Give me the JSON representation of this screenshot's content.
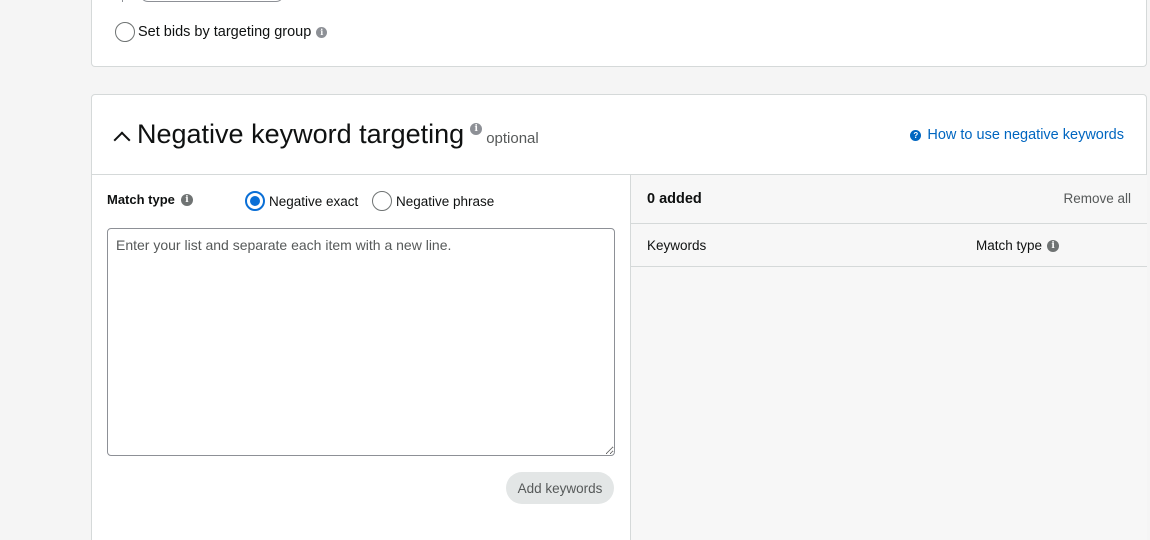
{
  "bidding": {
    "set_bids_by_group_label": "Set bids by targeting group"
  },
  "negative_keywords": {
    "title": "Negative keyword targeting",
    "optional_label": "optional",
    "help_link": "How to use negative keywords",
    "match_type_label": "Match type",
    "match_options": [
      {
        "label": "Negative exact",
        "selected": true
      },
      {
        "label": "Negative phrase",
        "selected": false
      }
    ],
    "textarea_placeholder": "Enter your list and separate each item with a new line.",
    "textarea_value": "",
    "add_button": "Add keywords",
    "added_count": "0 added",
    "remove_all": "Remove all",
    "columns": {
      "keywords": "Keywords",
      "match_type": "Match type"
    }
  },
  "colors": {
    "accent": "#0a6fd6",
    "link": "#0066c0",
    "border": "#d5d9d9"
  },
  "icons": [
    "info-icon",
    "chevron-up-icon",
    "help-circle-icon"
  ]
}
